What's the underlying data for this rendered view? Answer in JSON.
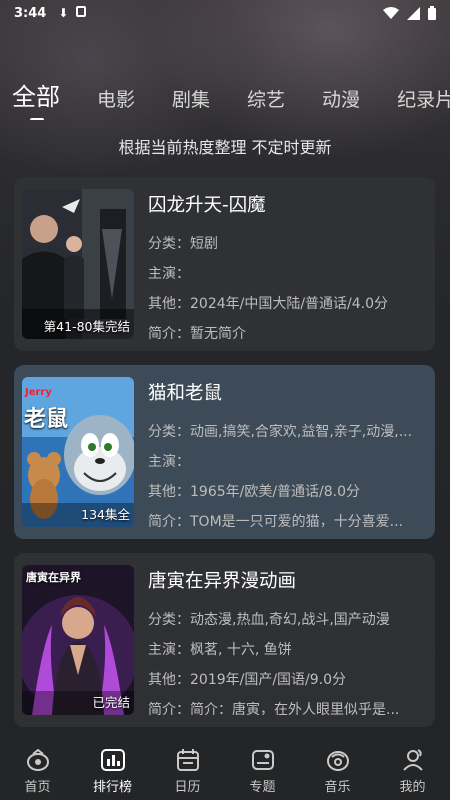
{
  "status": {
    "time": "3:44"
  },
  "tabs": [
    {
      "label": "全部"
    },
    {
      "label": "电影"
    },
    {
      "label": "剧集"
    },
    {
      "label": "综艺"
    },
    {
      "label": "动漫"
    },
    {
      "label": "纪录片"
    }
  ],
  "subtitle": "根据当前热度整理 不定时更新",
  "items": [
    {
      "title": "囚龙升天-囚魔",
      "badge": "第41-80集完结",
      "category_label": "分类：",
      "category": "短剧",
      "cast_label": "主演：",
      "cast": "",
      "other_label": "其他：",
      "other": "2024年/中国大陆/普通话/4.0分",
      "intro_label": "简介：",
      "intro": "暂无简介"
    },
    {
      "title": "猫和老鼠",
      "badge": "134集全",
      "category_label": "分类：",
      "category": "动画,搞笑,合家欢,益智,亲子,动漫,...",
      "cast_label": "主演：",
      "cast": "",
      "other_label": "其他：",
      "other": "1965年/欧美/普通话/8.0分",
      "intro_label": "简介：",
      "intro": "TOM是一只可爱的猫，十分喜爱..."
    },
    {
      "title": "唐寅在异界漫动画",
      "badge": "已完结",
      "category_label": "分类：",
      "category": "动态漫,热血,奇幻,战斗,国产动漫",
      "cast_label": "主演：",
      "cast": "枫茗, 十六, 鱼饼",
      "other_label": "其他：",
      "other": "2019年/国产/国语/9.0分",
      "intro_label": "简介：",
      "intro": "简介：唐寅，在外人眼里似乎是..."
    }
  ],
  "poster_texts": {
    "tom_logo": "老鼠",
    "tom_small": "Jerry",
    "tang_logo": "唐寅在异界"
  },
  "nav": [
    {
      "label": "首页",
      "icon": "home-icon"
    },
    {
      "label": "排行榜",
      "icon": "ranking-icon"
    },
    {
      "label": "日历",
      "icon": "calendar-icon"
    },
    {
      "label": "专题",
      "icon": "topic-icon"
    },
    {
      "label": "音乐",
      "icon": "music-icon"
    },
    {
      "label": "我的",
      "icon": "profile-icon"
    }
  ],
  "colors": {
    "accent": "#ffffff",
    "card": "#303135",
    "card_highlight": "#3d4a57",
    "background": "#232528"
  }
}
